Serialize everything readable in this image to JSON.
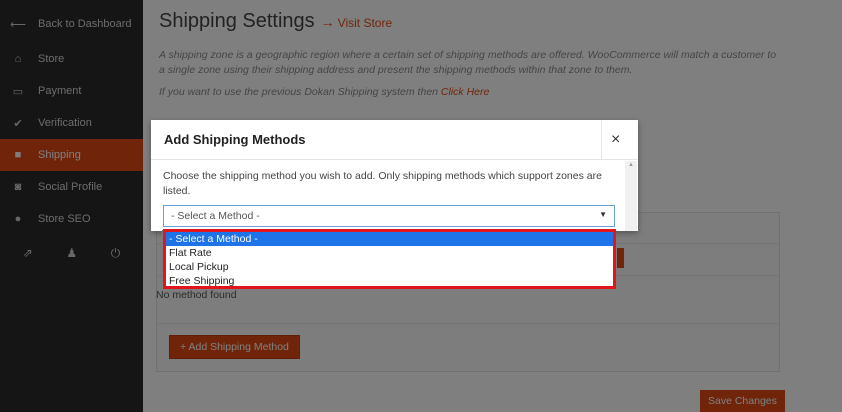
{
  "sidebar": {
    "items": [
      {
        "icon": "arrow-left-icon",
        "glyph": "⟵",
        "label": "Back to Dashboard"
      },
      {
        "icon": "bank-icon",
        "glyph": "⌂",
        "label": "Store"
      },
      {
        "icon": "credit-card-icon",
        "glyph": "▭",
        "label": "Payment"
      },
      {
        "icon": "check-icon",
        "glyph": "✔",
        "label": "Verification"
      },
      {
        "icon": "truck-icon",
        "glyph": "■",
        "label": "Shipping"
      },
      {
        "icon": "share-icon",
        "glyph": "◙",
        "label": "Social Profile"
      },
      {
        "icon": "globe-icon",
        "glyph": "●",
        "label": "Store SEO"
      }
    ],
    "bottom_icons": [
      {
        "icon": "external-link-icon",
        "glyph": "⇗"
      },
      {
        "icon": "user-icon",
        "glyph": "♟"
      },
      {
        "icon": "power-icon",
        "glyph": "⏻"
      }
    ]
  },
  "main": {
    "title": "Shipping Settings",
    "arrow": "→",
    "visit_link": "Visit Store",
    "description": "A shipping zone is a geographic region where a certain set of shipping methods are offered. WooCommerce will match a customer to a single zone using their shipping address and present the shipping methods within that zone to them.",
    "legacy_text": "If you want to use the previous Dokan Shipping system then ",
    "legacy_link": "Click Here",
    "no_method": "No method found",
    "add_method_button": "+ Add Shipping Method",
    "save_button": "Save Changes"
  },
  "modal": {
    "title": "Add Shipping Methods",
    "close": "×",
    "text": "Choose the shipping method you wish to add. Only shipping methods which support zones are listed.",
    "select_value": "- Select a Method -",
    "options": [
      "- Select a Method -",
      "Flat Rate",
      "Local Pickup",
      "Free Shipping"
    ]
  },
  "colors": {
    "accent": "#e04a16",
    "sidebar_bg": "#2a2a2a",
    "selected_option": "#1e73e8",
    "highlight_border": "#e0161c"
  }
}
